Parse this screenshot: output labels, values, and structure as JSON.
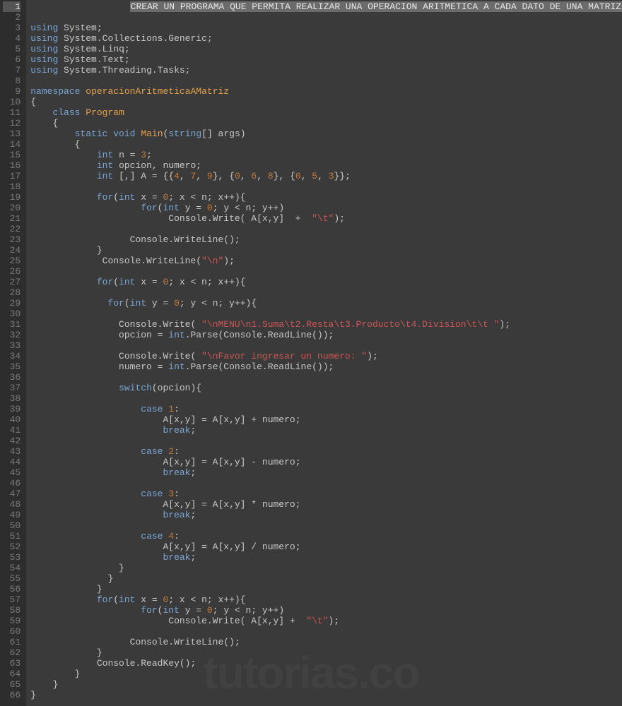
{
  "watermark": "tutorias.co",
  "lines": [
    {
      "n": 1,
      "active": true,
      "segs": [
        {
          "t": "                  ",
          "c": "pn"
        },
        {
          "t": "CREAR UN PROGRAMA QUE PERMITA REALIZAR UNA OPERACION ARITMETICA A CADA DATO DE UNA MATRIZ",
          "c": "sel"
        }
      ]
    },
    {
      "n": 2,
      "segs": []
    },
    {
      "n": 3,
      "segs": [
        {
          "t": "using",
          "c": "kw"
        },
        {
          "t": " System;",
          "c": "pn"
        }
      ]
    },
    {
      "n": 4,
      "segs": [
        {
          "t": "using",
          "c": "kw"
        },
        {
          "t": " System.Collections.Generic;",
          "c": "pn"
        }
      ]
    },
    {
      "n": 5,
      "segs": [
        {
          "t": "using",
          "c": "kw"
        },
        {
          "t": " System.Linq;",
          "c": "pn"
        }
      ]
    },
    {
      "n": 6,
      "segs": [
        {
          "t": "using",
          "c": "kw"
        },
        {
          "t": " System.Text;",
          "c": "pn"
        }
      ]
    },
    {
      "n": 7,
      "segs": [
        {
          "t": "using",
          "c": "kw"
        },
        {
          "t": " System.Threading.Tasks;",
          "c": "pn"
        }
      ]
    },
    {
      "n": 8,
      "segs": []
    },
    {
      "n": 9,
      "segs": [
        {
          "t": "namespace",
          "c": "kw"
        },
        {
          "t": " ",
          "c": "pn"
        },
        {
          "t": "operacionAritmeticaAMatriz",
          "c": "cls"
        }
      ]
    },
    {
      "n": 10,
      "segs": [
        {
          "t": "{",
          "c": "pn"
        }
      ]
    },
    {
      "n": 11,
      "segs": [
        {
          "t": "    ",
          "c": "pn"
        },
        {
          "t": "class",
          "c": "kw"
        },
        {
          "t": " ",
          "c": "pn"
        },
        {
          "t": "Program",
          "c": "cls"
        }
      ]
    },
    {
      "n": 12,
      "segs": [
        {
          "t": "    {",
          "c": "pn"
        }
      ]
    },
    {
      "n": 13,
      "segs": [
        {
          "t": "        ",
          "c": "pn"
        },
        {
          "t": "static",
          "c": "kw"
        },
        {
          "t": " ",
          "c": "pn"
        },
        {
          "t": "void",
          "c": "kw"
        },
        {
          "t": " ",
          "c": "pn"
        },
        {
          "t": "Main",
          "c": "mth"
        },
        {
          "t": "(",
          "c": "pn"
        },
        {
          "t": "string",
          "c": "type"
        },
        {
          "t": "[] args)",
          "c": "pn"
        }
      ]
    },
    {
      "n": 14,
      "segs": [
        {
          "t": "        {",
          "c": "pn"
        }
      ]
    },
    {
      "n": 15,
      "segs": [
        {
          "t": "            ",
          "c": "pn"
        },
        {
          "t": "int",
          "c": "type"
        },
        {
          "t": " n = ",
          "c": "pn"
        },
        {
          "t": "3",
          "c": "num"
        },
        {
          "t": ";",
          "c": "pn"
        }
      ]
    },
    {
      "n": 16,
      "segs": [
        {
          "t": "            ",
          "c": "pn"
        },
        {
          "t": "int",
          "c": "type"
        },
        {
          "t": " opcion, numero;",
          "c": "pn"
        }
      ]
    },
    {
      "n": 17,
      "segs": [
        {
          "t": "            ",
          "c": "pn"
        },
        {
          "t": "int",
          "c": "type"
        },
        {
          "t": " [,] A = {{",
          "c": "pn"
        },
        {
          "t": "4",
          "c": "num"
        },
        {
          "t": ", ",
          "c": "pn"
        },
        {
          "t": "7",
          "c": "num"
        },
        {
          "t": ", ",
          "c": "pn"
        },
        {
          "t": "9",
          "c": "num"
        },
        {
          "t": "}, {",
          "c": "pn"
        },
        {
          "t": "0",
          "c": "num"
        },
        {
          "t": ", ",
          "c": "pn"
        },
        {
          "t": "6",
          "c": "num"
        },
        {
          "t": ", ",
          "c": "pn"
        },
        {
          "t": "8",
          "c": "num"
        },
        {
          "t": "}, {",
          "c": "pn"
        },
        {
          "t": "0",
          "c": "num"
        },
        {
          "t": ", ",
          "c": "pn"
        },
        {
          "t": "5",
          "c": "num"
        },
        {
          "t": ", ",
          "c": "pn"
        },
        {
          "t": "3",
          "c": "num"
        },
        {
          "t": "}};",
          "c": "pn"
        }
      ]
    },
    {
      "n": 18,
      "segs": []
    },
    {
      "n": 19,
      "segs": [
        {
          "t": "            ",
          "c": "pn"
        },
        {
          "t": "for",
          "c": "kw"
        },
        {
          "t": "(",
          "c": "pn"
        },
        {
          "t": "int",
          "c": "type"
        },
        {
          "t": " x = ",
          "c": "pn"
        },
        {
          "t": "0",
          "c": "num"
        },
        {
          "t": "; x < n; x++){",
          "c": "pn"
        }
      ]
    },
    {
      "n": 20,
      "segs": [
        {
          "t": "                    ",
          "c": "pn"
        },
        {
          "t": "for",
          "c": "kw"
        },
        {
          "t": "(",
          "c": "pn"
        },
        {
          "t": "int",
          "c": "type"
        },
        {
          "t": " y = ",
          "c": "pn"
        },
        {
          "t": "0",
          "c": "num"
        },
        {
          "t": "; y < n; y++)",
          "c": "pn"
        }
      ]
    },
    {
      "n": 21,
      "segs": [
        {
          "t": "                         Console.Write( A[x,y]  +  ",
          "c": "pn"
        },
        {
          "t": "\"\\t\"",
          "c": "str"
        },
        {
          "t": ");",
          "c": "pn"
        }
      ]
    },
    {
      "n": 22,
      "segs": []
    },
    {
      "n": 23,
      "segs": [
        {
          "t": "                  Console.WriteLine();",
          "c": "pn"
        }
      ]
    },
    {
      "n": 24,
      "segs": [
        {
          "t": "            }",
          "c": "pn"
        }
      ]
    },
    {
      "n": 25,
      "segs": [
        {
          "t": "             Console.WriteLine(",
          "c": "pn"
        },
        {
          "t": "\"\\n\"",
          "c": "str"
        },
        {
          "t": ");",
          "c": "pn"
        }
      ]
    },
    {
      "n": 26,
      "segs": []
    },
    {
      "n": 27,
      "segs": [
        {
          "t": "            ",
          "c": "pn"
        },
        {
          "t": "for",
          "c": "kw"
        },
        {
          "t": "(",
          "c": "pn"
        },
        {
          "t": "int",
          "c": "type"
        },
        {
          "t": " x = ",
          "c": "pn"
        },
        {
          "t": "0",
          "c": "num"
        },
        {
          "t": "; x < n; x++){",
          "c": "pn"
        }
      ]
    },
    {
      "n": 28,
      "segs": []
    },
    {
      "n": 29,
      "segs": [
        {
          "t": "              ",
          "c": "pn"
        },
        {
          "t": "for",
          "c": "kw"
        },
        {
          "t": "(",
          "c": "pn"
        },
        {
          "t": "int",
          "c": "type"
        },
        {
          "t": " y = ",
          "c": "pn"
        },
        {
          "t": "0",
          "c": "num"
        },
        {
          "t": "; y < n; y++){",
          "c": "pn"
        }
      ]
    },
    {
      "n": 30,
      "segs": []
    },
    {
      "n": 31,
      "segs": [
        {
          "t": "                Console.Write( ",
          "c": "pn"
        },
        {
          "t": "\"\\n",
          "c": "str"
        },
        {
          "t": "MENU",
          "c": "str"
        },
        {
          "t": "\\n",
          "c": "str"
        },
        {
          "t": "1.Suma",
          "c": "str"
        },
        {
          "t": "\\t",
          "c": "str"
        },
        {
          "t": "2.Resta",
          "c": "str"
        },
        {
          "t": "\\t",
          "c": "str"
        },
        {
          "t": "3.Producto",
          "c": "str"
        },
        {
          "t": "\\t",
          "c": "str"
        },
        {
          "t": "4.Division",
          "c": "str"
        },
        {
          "t": "\\t\\t \"",
          "c": "str"
        },
        {
          "t": ");",
          "c": "pn"
        }
      ]
    },
    {
      "n": 32,
      "segs": [
        {
          "t": "                opcion = ",
          "c": "pn"
        },
        {
          "t": "int",
          "c": "type"
        },
        {
          "t": ".Parse(Console.ReadLine());",
          "c": "pn"
        }
      ]
    },
    {
      "n": 33,
      "segs": []
    },
    {
      "n": 34,
      "segs": [
        {
          "t": "                Console.Write( ",
          "c": "pn"
        },
        {
          "t": "\"\\n",
          "c": "str"
        },
        {
          "t": "Favor ingresar un numero: ",
          "c": "str"
        },
        {
          "t": "\"",
          "c": "str"
        },
        {
          "t": ");",
          "c": "pn"
        }
      ]
    },
    {
      "n": 35,
      "segs": [
        {
          "t": "                numero = ",
          "c": "pn"
        },
        {
          "t": "int",
          "c": "type"
        },
        {
          "t": ".Parse(Console.ReadLine());",
          "c": "pn"
        }
      ]
    },
    {
      "n": 36,
      "segs": []
    },
    {
      "n": 37,
      "segs": [
        {
          "t": "                ",
          "c": "pn"
        },
        {
          "t": "switch",
          "c": "kw"
        },
        {
          "t": "(opcion){",
          "c": "pn"
        }
      ]
    },
    {
      "n": 38,
      "segs": []
    },
    {
      "n": 39,
      "segs": [
        {
          "t": "                    ",
          "c": "pn"
        },
        {
          "t": "case",
          "c": "kw"
        },
        {
          "t": " ",
          "c": "pn"
        },
        {
          "t": "1",
          "c": "num"
        },
        {
          "t": ":",
          "c": "pn"
        }
      ]
    },
    {
      "n": 40,
      "segs": [
        {
          "t": "                        A[x,y] = A[x,y] + numero;",
          "c": "pn"
        }
      ]
    },
    {
      "n": 41,
      "segs": [
        {
          "t": "                        ",
          "c": "pn"
        },
        {
          "t": "break",
          "c": "kw"
        },
        {
          "t": ";",
          "c": "pn"
        }
      ]
    },
    {
      "n": 42,
      "segs": []
    },
    {
      "n": 43,
      "segs": [
        {
          "t": "                    ",
          "c": "pn"
        },
        {
          "t": "case",
          "c": "kw"
        },
        {
          "t": " ",
          "c": "pn"
        },
        {
          "t": "2",
          "c": "num"
        },
        {
          "t": ":",
          "c": "pn"
        }
      ]
    },
    {
      "n": 44,
      "segs": [
        {
          "t": "                        A[x,y] = A[x,y] - numero;",
          "c": "pn"
        }
      ]
    },
    {
      "n": 45,
      "segs": [
        {
          "t": "                        ",
          "c": "pn"
        },
        {
          "t": "break",
          "c": "kw"
        },
        {
          "t": ";",
          "c": "pn"
        }
      ]
    },
    {
      "n": 46,
      "segs": []
    },
    {
      "n": 47,
      "segs": [
        {
          "t": "                    ",
          "c": "pn"
        },
        {
          "t": "case",
          "c": "kw"
        },
        {
          "t": " ",
          "c": "pn"
        },
        {
          "t": "3",
          "c": "num"
        },
        {
          "t": ":",
          "c": "pn"
        }
      ]
    },
    {
      "n": 48,
      "segs": [
        {
          "t": "                        A[x,y] = A[x,y] * numero;",
          "c": "pn"
        }
      ]
    },
    {
      "n": 49,
      "segs": [
        {
          "t": "                        ",
          "c": "pn"
        },
        {
          "t": "break",
          "c": "kw"
        },
        {
          "t": ";",
          "c": "pn"
        }
      ]
    },
    {
      "n": 50,
      "segs": []
    },
    {
      "n": 51,
      "segs": [
        {
          "t": "                    ",
          "c": "pn"
        },
        {
          "t": "case",
          "c": "kw"
        },
        {
          "t": " ",
          "c": "pn"
        },
        {
          "t": "4",
          "c": "num"
        },
        {
          "t": ":",
          "c": "pn"
        }
      ]
    },
    {
      "n": 52,
      "segs": [
        {
          "t": "                        A[x,y] = A[x,y] / numero;",
          "c": "pn"
        }
      ]
    },
    {
      "n": 53,
      "segs": [
        {
          "t": "                        ",
          "c": "pn"
        },
        {
          "t": "break",
          "c": "kw"
        },
        {
          "t": ";",
          "c": "pn"
        }
      ]
    },
    {
      "n": 54,
      "segs": [
        {
          "t": "                }",
          "c": "pn"
        }
      ]
    },
    {
      "n": 55,
      "segs": [
        {
          "t": "              }",
          "c": "pn"
        }
      ]
    },
    {
      "n": 56,
      "segs": [
        {
          "t": "            }",
          "c": "pn"
        }
      ]
    },
    {
      "n": 57,
      "segs": [
        {
          "t": "            ",
          "c": "pn"
        },
        {
          "t": "for",
          "c": "kw"
        },
        {
          "t": "(",
          "c": "pn"
        },
        {
          "t": "int",
          "c": "type"
        },
        {
          "t": " x = ",
          "c": "pn"
        },
        {
          "t": "0",
          "c": "num"
        },
        {
          "t": "; x < n; x++){",
          "c": "pn"
        }
      ]
    },
    {
      "n": 58,
      "segs": [
        {
          "t": "                    ",
          "c": "pn"
        },
        {
          "t": "for",
          "c": "kw"
        },
        {
          "t": "(",
          "c": "pn"
        },
        {
          "t": "int",
          "c": "type"
        },
        {
          "t": " y = ",
          "c": "pn"
        },
        {
          "t": "0",
          "c": "num"
        },
        {
          "t": "; y < n; y++)",
          "c": "pn"
        }
      ]
    },
    {
      "n": 59,
      "segs": [
        {
          "t": "                         Console.Write( A[x,y] +  ",
          "c": "pn"
        },
        {
          "t": "\"\\t\"",
          "c": "str"
        },
        {
          "t": ");",
          "c": "pn"
        }
      ]
    },
    {
      "n": 60,
      "segs": []
    },
    {
      "n": 61,
      "segs": [
        {
          "t": "                  Console.WriteLine();",
          "c": "pn"
        }
      ]
    },
    {
      "n": 62,
      "segs": [
        {
          "t": "            }",
          "c": "pn"
        }
      ]
    },
    {
      "n": 63,
      "segs": [
        {
          "t": "            Console.ReadKey();",
          "c": "pn"
        }
      ]
    },
    {
      "n": 64,
      "segs": [
        {
          "t": "        }",
          "c": "pn"
        }
      ]
    },
    {
      "n": 65,
      "segs": [
        {
          "t": "    }",
          "c": "pn"
        }
      ]
    },
    {
      "n": 66,
      "segs": [
        {
          "t": "}",
          "c": "pn"
        }
      ]
    }
  ]
}
